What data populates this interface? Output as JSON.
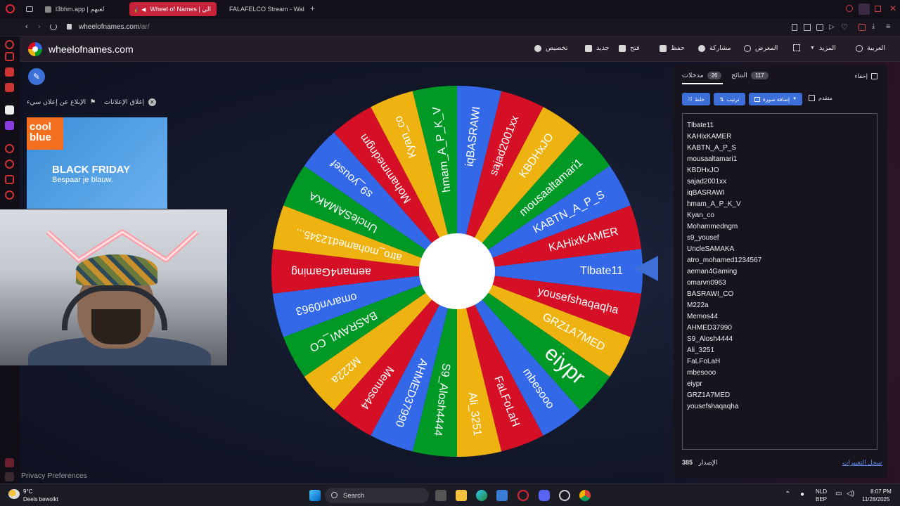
{
  "browser": {
    "tabs": [
      {
        "label": "l3bhm.app | لعبهم"
      },
      {
        "label": "Wheel of Names | الي"
      },
      {
        "label": "FALAFELCO Stream - Wal"
      }
    ],
    "new_tab": "+",
    "url_host": "wheelofnames.com",
    "url_path": "/ar/"
  },
  "site": {
    "name": "wheelofnames.com",
    "nav": {
      "language": "العربية",
      "more": "المزيد",
      "gallery": "المعرض",
      "share": "مشاركة",
      "save": "حفظ",
      "open": "فتح",
      "new": "جديد",
      "customize": "تخصيص"
    }
  },
  "ads": {
    "report": "الإبلاغ عن إعلان سيء",
    "close_ads": "إغلاق الإعلانات",
    "brand_line1": "cool",
    "brand_line2": "blue",
    "headline": "BLACK FRIDAY",
    "tagline": "Bespaar je blauw."
  },
  "panel": {
    "tab_entries": "مدخلات",
    "entries_count": "26",
    "tab_results": "النتائج",
    "results_count": "117",
    "hide": "إخفاء",
    "shuffle": "خلط",
    "sort": "ترتيب",
    "add_image": "إضافة صورة",
    "advanced": "متقدم",
    "version_label": "الإصدار",
    "version": "385",
    "changelog": "سجل التغييرات"
  },
  "entries": [
    "Tlbate11",
    "KAHixKAMER",
    "KABTN_A_P_S",
    "mousaaltamari1",
    "KBDHxJO",
    "sajad2001xx",
    "iqBASRAWI",
    "hmam_A_P_K_V",
    "Kyan_co",
    "Mohammedngm",
    "s9_yousef",
    "UncleSAMAKA",
    "atro_mohamed1234567",
    "aeman4Gaming",
    "omarvn0963",
    "BASRAWI_CO",
    "M222a",
    "Memos44",
    "AHMED37990",
    "S9_Alosh4444",
    "Ali_3251",
    "FaLFoLaH",
    "mbesooo",
    "eiypr",
    "GRZ1A7MED",
    "yousefshaqaqha"
  ],
  "wheel": {
    "colors": [
      "#3369e8",
      "#d50f25",
      "#eeb211",
      "#009925"
    ],
    "slice_labels": [
      "Tlbate11",
      "yousefshaqaqha",
      "GRZ1A7MED",
      "eiypr",
      "mbesooo",
      "FaLFoLaH",
      "Ali_3251",
      "S9_Alosh4444",
      "AHMED37990",
      "Memos44",
      "M222a",
      "BASRAWI_CO",
      "omarvn0963",
      "aeman4Gaming",
      "atro_mohamed12345...",
      "UncleSAMAKA",
      "s9_yousef",
      "Mohammedngm",
      "Kyan_co",
      "hmam_A_P_K_V",
      "iqBASRAWI",
      "sajad2001xx",
      "KBDHxJO",
      "mousaaltamari1",
      "KABTN_A_P_S",
      "KAHixKAMER"
    ]
  },
  "privacy": "Privacy Preferences",
  "taskbar": {
    "weather_temp": "9°C",
    "weather_desc": "Deels bewolkt",
    "search": "Search",
    "lang1": "NLD",
    "lang2": "BEP",
    "time": "8:07 PM",
    "date": "11/28/2025"
  }
}
